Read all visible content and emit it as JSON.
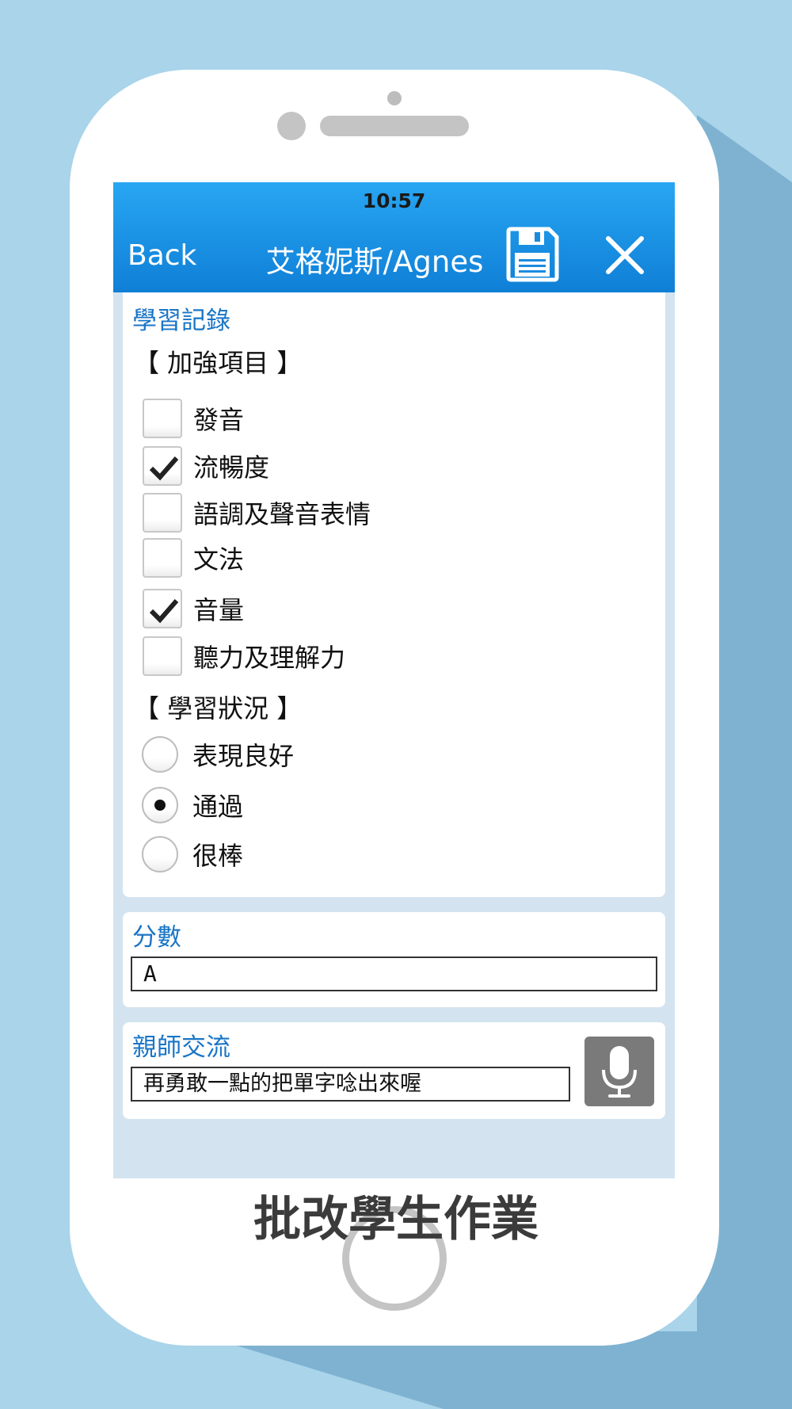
{
  "app": {
    "status_time": "10:57",
    "back_label": "Back",
    "title": "艾格妮斯/Agnes",
    "save_icon": "floppy-disk-icon",
    "close_icon": "close-icon"
  },
  "record": {
    "section_title": "學習記錄",
    "focus_group_label": "【 加強項目 】",
    "focus_items": [
      {
        "label": "發音",
        "checked": false
      },
      {
        "label": "流暢度",
        "checked": true
      },
      {
        "label": "語調及聲音表情",
        "checked": false
      },
      {
        "label": "文法",
        "checked": false
      },
      {
        "label": "音量",
        "checked": true
      },
      {
        "label": "聽力及理解力",
        "checked": false
      }
    ],
    "status_group_label": "【 學習狀況 】",
    "status_options": [
      {
        "label": "表現良好",
        "selected": false
      },
      {
        "label": "通過",
        "selected": true
      },
      {
        "label": "很棒",
        "selected": false
      }
    ]
  },
  "score": {
    "section_title": "分數",
    "value": "A"
  },
  "communication": {
    "section_title": "親師交流",
    "value": "再勇敢一點的把單字唸出來喔",
    "mic_icon": "microphone-icon"
  },
  "caption": "批改學生作業",
  "colors": {
    "background": "#a9d4ea",
    "nav_blue": "#1a90e0",
    "section_title": "#1975c6"
  }
}
